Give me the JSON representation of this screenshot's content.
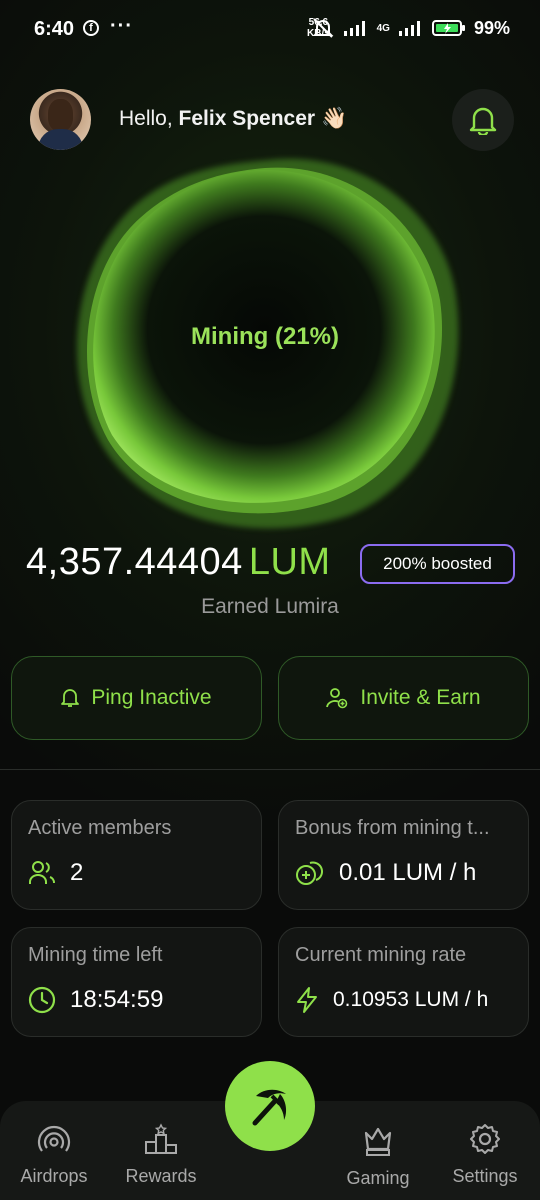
{
  "status_bar": {
    "time": "6:40",
    "notif_dots": "···",
    "speed_value": "56.6",
    "speed_unit": "KB/s",
    "network": "4G",
    "battery": "99%"
  },
  "header": {
    "greeting_prefix": "Hello, ",
    "user_name": "Felix Spencer",
    "wave_emoji": "👋🏻"
  },
  "mining": {
    "status_label": "Mining (21%)",
    "progress_percent": 21
  },
  "balance": {
    "amount": "4,357.44404",
    "unit": "LUM",
    "boost_label": "200% boosted",
    "caption": "Earned Lumira"
  },
  "actions": {
    "ping_label": "Ping Inactive",
    "invite_label": "Invite & Earn"
  },
  "stats": {
    "active_members": {
      "title": "Active members",
      "value": "2"
    },
    "bonus": {
      "title": "Bonus from mining t...",
      "value": "0.01 LUM / h"
    },
    "time_left": {
      "title": "Mining time left",
      "value": "18:54:59"
    },
    "rate": {
      "title": "Current mining rate",
      "value": "0.10953 LUM / h"
    }
  },
  "nav": {
    "airdrops": "Airdrops",
    "rewards": "Rewards",
    "gaming": "Gaming",
    "settings": "Settings"
  },
  "colors": {
    "accent_green": "#8fe04a",
    "boost_border": "#8b6cf0",
    "background": "#0a0c0a"
  },
  "icons": {
    "bell": "bell-icon",
    "ping": "bell-outline-icon",
    "invite": "user-plus-icon",
    "members": "users-icon",
    "bonus": "coins-icon",
    "clock": "clock-icon",
    "bolt": "bolt-icon",
    "mine": "pickaxe-icon"
  }
}
